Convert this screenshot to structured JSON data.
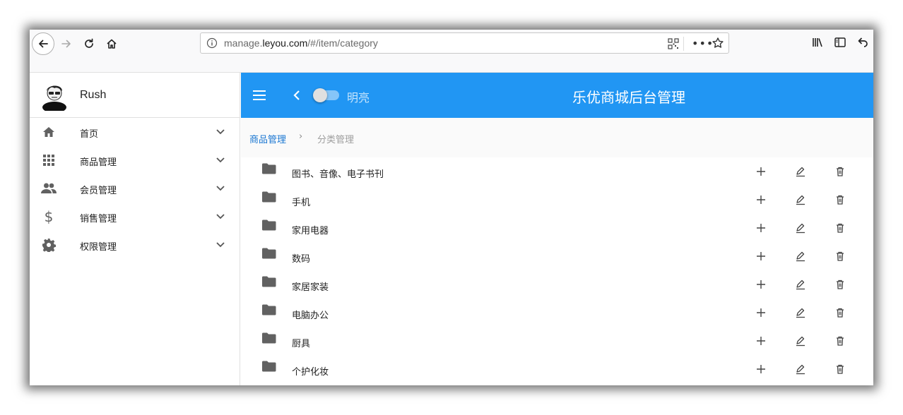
{
  "browser": {
    "url_prefix": "manage.",
    "url_domain": "leyou.com",
    "url_path": "/#/item/category"
  },
  "sidebar": {
    "user_name": "Rush",
    "items": [
      {
        "label": "首页",
        "icon": "home-icon"
      },
      {
        "label": "商品管理",
        "icon": "apps-icon"
      },
      {
        "label": "会员管理",
        "icon": "people-icon"
      },
      {
        "label": "销售管理",
        "icon": "dollar-icon"
      },
      {
        "label": "权限管理",
        "icon": "gear-icon"
      }
    ]
  },
  "header": {
    "theme_toggle_label": "明亮",
    "title": "乐优商城后台管理",
    "accent_color": "#2196f3"
  },
  "breadcrumb": {
    "parent": "商品管理",
    "separator": "›",
    "current": "分类管理"
  },
  "categories": [
    {
      "name": "图书、音像、电子书刊"
    },
    {
      "name": "手机"
    },
    {
      "name": "家用电器"
    },
    {
      "name": "数码"
    },
    {
      "name": "家居家装"
    },
    {
      "name": "电脑办公"
    },
    {
      "name": "厨具"
    },
    {
      "name": "个护化妆"
    }
  ]
}
